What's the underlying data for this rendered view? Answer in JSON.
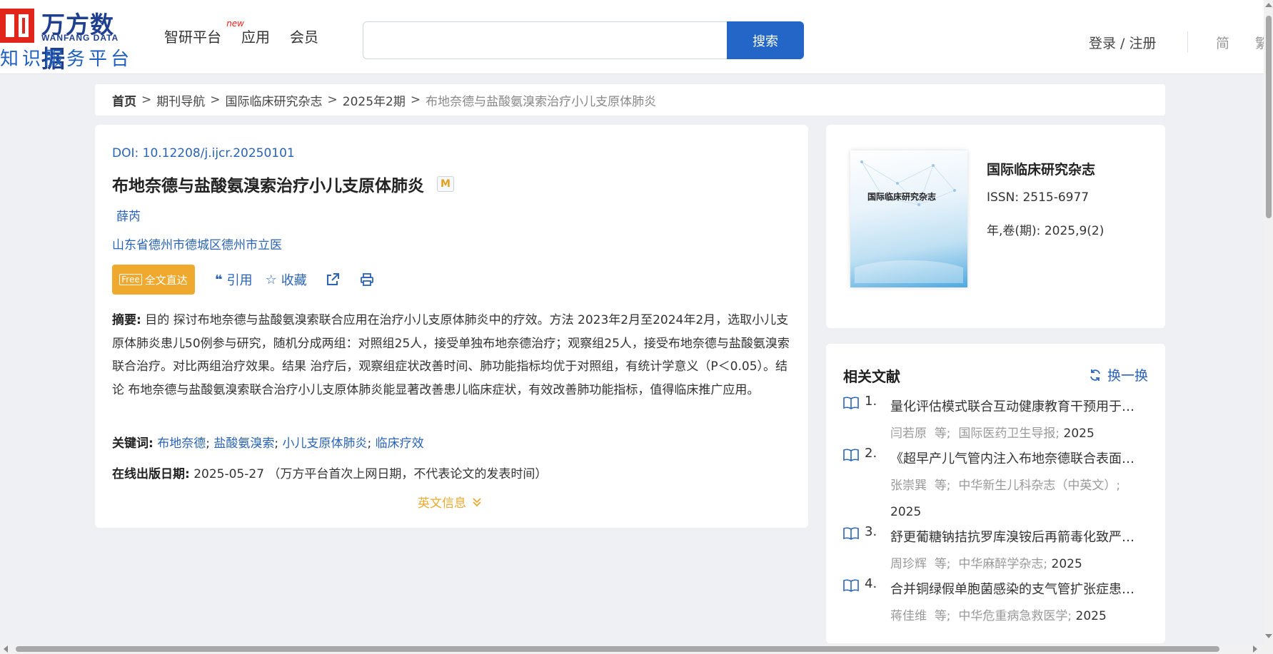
{
  "logo": {
    "cn": "万方数据",
    "en": "WANFANG DATA",
    "sub": "知识服务平台"
  },
  "nav": {
    "items": [
      {
        "label": "智研平台",
        "badge": "new"
      },
      {
        "label": "应用"
      },
      {
        "label": "会员"
      }
    ]
  },
  "search": {
    "value": "",
    "placeholder": "",
    "button_label": "搜索"
  },
  "header": {
    "login": "登录 / 注册",
    "lang_simplified": "简",
    "lang_traditional": "繁"
  },
  "breadcrumb": {
    "items": [
      "首页",
      "期刊导航",
      "国际临床研究杂志",
      "2025年2期"
    ],
    "current": "布地奈德与盐酸氨溴索治疗小儿支原体肺炎",
    "separator": ">"
  },
  "article": {
    "doi_label": "DOI: ",
    "doi": "10.12208/j.ijcr.20250101",
    "title": "布地奈德与盐酸氨溴索治疗小儿支原体肺炎",
    "badge": "M",
    "author": "薛芮",
    "org": "山东省德州市德城区德州市立医",
    "actions": {
      "fulltext": "全文直达",
      "fulltext_icon": "Free",
      "cite": "引用",
      "favorite": "收藏"
    },
    "abstract_label": "摘要:",
    "abstract": " 目的 探讨布地奈德与盐酸氨溴索联合应用在治疗小儿支原体肺炎中的疗效。方法 2023年2月至2024年2月，选取小儿支原体肺炎患儿50例参与研究，随机分成两组：对照组25人，接受单独布地奈德治疗；观察组25人，接受布地奈德与盐酸氨溴索联合治疗。对比两组治疗效果。结果 治疗后，观察组症状改善时间、肺功能指标均优于对照组，有统计学意义（P＜0.05）。结论 布地奈德与盐酸氨溴索联合治疗小儿支原体肺炎能显著改善患儿临床症状，有效改善肺功能指标，值得临床推广应用。",
    "keywords_label": "关键词:",
    "keywords": [
      "布地奈德",
      "盐酸氨溴索",
      "小儿支原体肺炎",
      "临床疗效"
    ],
    "date_label": "在线出版日期:",
    "date": "2025-05-27",
    "date_note": "（万方平台首次上网日期，不代表论文的发表时间）",
    "en_info": "英文信息"
  },
  "journal": {
    "cover_title": "国际临床研究杂志",
    "name": "国际临床研究杂志",
    "issn_label": "ISSN:",
    "issn": "2515-6977",
    "vol_label": "年,卷(期):",
    "vol": "2025,9(2)"
  },
  "related": {
    "title": "相关文献",
    "refresh": "换一换",
    "items": [
      {
        "num": "1.",
        "title": "量化评估模式联合互动健康教育干预用于肺...",
        "authors": "闫若原",
        "etc": "等;",
        "source": "国际医药卫生导报;",
        "year": "2025"
      },
      {
        "num": "2.",
        "title": "《超早产儿气管内注入布地奈德联合表面活...",
        "authors": "张崇巽",
        "etc": "等;",
        "source": "中华新生儿科杂志（中英文）;",
        "year": "2025"
      },
      {
        "num": "3.",
        "title": "舒更葡糖钠拮抗罗库溴铵后再箭毒化致严重...",
        "authors": "周珍辉",
        "etc": "等;",
        "source": "中华麻醉学杂志;",
        "year": "2025"
      },
      {
        "num": "4.",
        "title": "合并铜绿假单胞菌感染的支气管扩张症患者...",
        "authors": "蒋佳维",
        "etc": "等;",
        "source": "中华危重病急救医学;",
        "year": "2025"
      }
    ]
  },
  "colors": {
    "brand_red": "#e1251b",
    "brand_blue": "#1f3f8f",
    "link_blue": "#2a63b8",
    "accent_orange": "#f0a92f"
  }
}
